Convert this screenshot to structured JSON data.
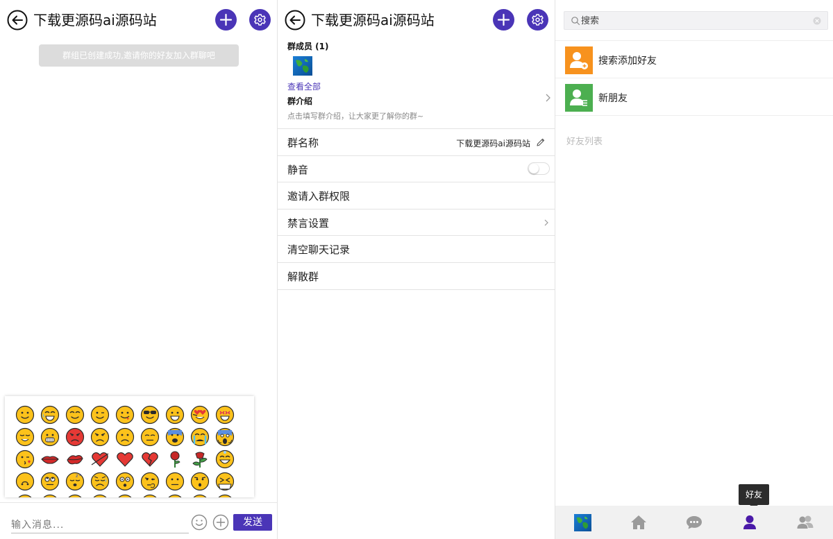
{
  "chat": {
    "title": "下载更源码ai源码站",
    "notice": "群组已创建成功,邀请你的好友加入群聊吧",
    "input_placeholder": "输入消息...",
    "send_label": "发送"
  },
  "settings": {
    "title": "下载更源码ai源码站",
    "members_title": "群成员 (1)",
    "view_all": "查看全部",
    "intro_title": "群介绍",
    "intro_hint": "点击填写群介绍，让大家更了解你的群~",
    "rows": {
      "group_name_label": "群名称",
      "group_name_value": "下载更源码ai源码站",
      "mute_label": "静音",
      "mute_on": false,
      "invite_label": "邀请入群权限",
      "ban_label": "禁言设置",
      "clear_label": "清空聊天记录",
      "dismiss_label": "解散群"
    }
  },
  "friends": {
    "search_placeholder": "搜索",
    "add_friend_label": "搜索添加好友",
    "new_friend_label": "新朋友",
    "section_title": "好友列表",
    "tooltip": "好友"
  },
  "nav": {
    "active": "friends",
    "items": [
      "avatar",
      "home",
      "messages",
      "friends",
      "groups"
    ]
  },
  "colors": {
    "accent": "#4a35b7",
    "orange": "#f7921e",
    "green": "#4caf50",
    "emoji_yellow": "#fcc21b"
  }
}
